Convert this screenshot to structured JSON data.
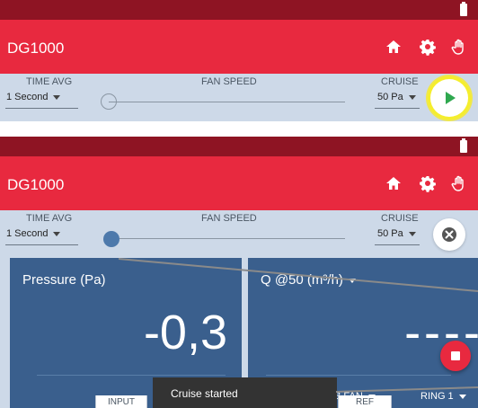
{
  "app": {
    "title": "DG1000"
  },
  "controls": {
    "time_avg_label": "TIME AVG",
    "time_avg_value": "1 Second",
    "fan_speed_label": "FAN SPEED",
    "cruise_label": "CRUISE",
    "cruise_value": "50 Pa"
  },
  "cards": {
    "pressure": {
      "title": "Pressure (Pa)",
      "value": "-0,3"
    },
    "flow": {
      "title": "Q @50 (m³/h)",
      "value": "----",
      "fan_label": "B FAN",
      "ring_label": "RING 1"
    }
  },
  "tabs": {
    "input": "INPUT",
    "ref": "REF"
  },
  "toast": {
    "message": "Cruise started"
  },
  "colors": {
    "status_bar": "#8e1423",
    "app_bar": "#e8293f",
    "controls_bg": "#cdd9e8",
    "card_bg": "#3a5f8d",
    "play_green": "#2fa84f",
    "highlight_yellow": "#f5ee2c"
  },
  "icons": [
    "home-icon",
    "gear-icon",
    "hand-icon",
    "battery-icon",
    "play-icon",
    "close-icon",
    "stop-icon",
    "caret-down-icon"
  ]
}
